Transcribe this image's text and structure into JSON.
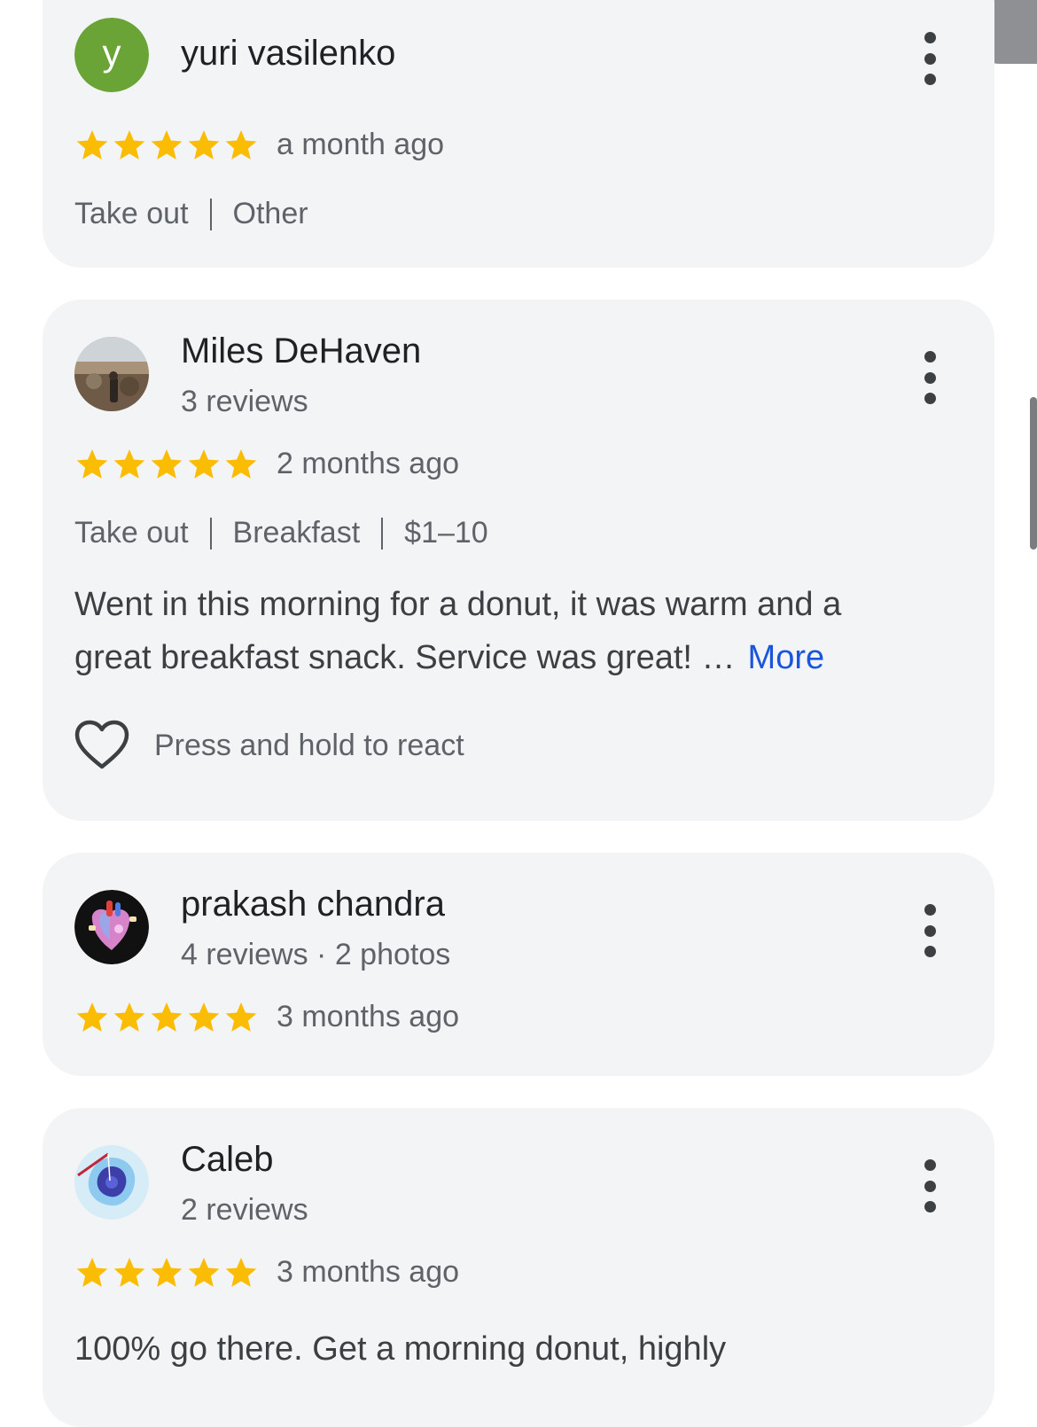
{
  "colors": {
    "star": "#fbbc04",
    "link": "#1a56db",
    "card": "#f3f4f6"
  },
  "reviews": [
    {
      "name": "yuri vasilenko",
      "avatar_letter": "y",
      "avatar_color": "#6aa336",
      "rating": 5,
      "time": "a month ago",
      "tags": [
        "Take out",
        "Other"
      ]
    },
    {
      "name": "Miles DeHaven",
      "stats": "3 reviews",
      "avatar_icon": "landscape-photo-avatar",
      "rating": 5,
      "time": "2 months ago",
      "tags": [
        "Take out",
        "Breakfast",
        "$1–10"
      ],
      "text_line1": "Went in this morning for a donut, it was warm and a",
      "text_line2": "great breakfast snack. Service was great! …",
      "more_label": "More",
      "react_label": "Press and hold to react",
      "react_icon": "heart-outline-icon"
    },
    {
      "name": "prakash chandra",
      "stats": "4 reviews · 2 photos",
      "avatar_icon": "heart-anatomy-avatar",
      "rating": 5,
      "time": "3 months ago"
    },
    {
      "name": "Caleb",
      "stats": "2 reviews",
      "avatar_icon": "cell-illustration-avatar",
      "rating": 5,
      "time": "3 months ago",
      "text_line1": "100% go there. Get a morning donut, highly"
    }
  ]
}
